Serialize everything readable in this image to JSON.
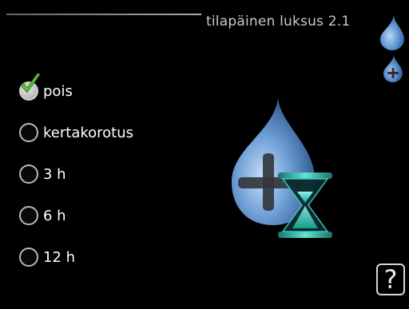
{
  "header": {
    "title": "tilapäinen luksus 2.1"
  },
  "side_icons": [
    "water-drop-icon",
    "water-drop-plus-icon"
  ],
  "options": [
    {
      "label": "pois",
      "selected": true
    },
    {
      "label": "kertakorotus",
      "selected": false
    },
    {
      "label": "3 h",
      "selected": false
    },
    {
      "label": "6 h",
      "selected": false
    },
    {
      "label": "12 h",
      "selected": false
    }
  ],
  "illustration": "hot-water-drop-hourglass-icon",
  "help": {
    "label": "?"
  },
  "colors": {
    "background": "#000000",
    "drop_blue": "#6f9fd6",
    "hourglass_teal": "#3ad6c4",
    "check_green": "#5cc43a"
  }
}
